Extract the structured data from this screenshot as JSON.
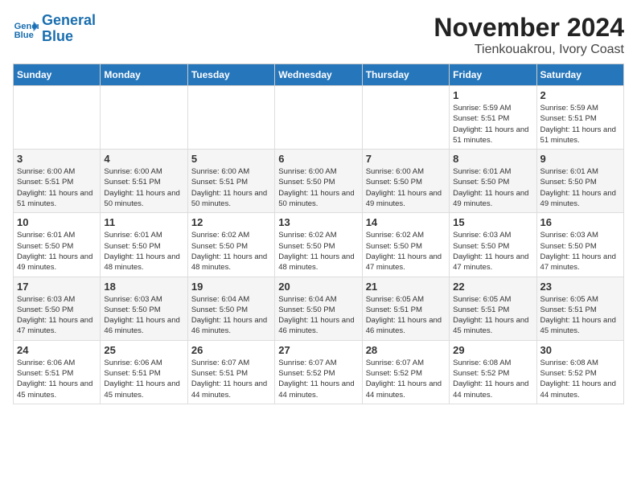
{
  "logo": {
    "line1": "General",
    "line2": "Blue"
  },
  "title": "November 2024",
  "subtitle": "Tienkouakrou, Ivory Coast",
  "days_of_week": [
    "Sunday",
    "Monday",
    "Tuesday",
    "Wednesday",
    "Thursday",
    "Friday",
    "Saturday"
  ],
  "weeks": [
    [
      {
        "day": "",
        "info": ""
      },
      {
        "day": "",
        "info": ""
      },
      {
        "day": "",
        "info": ""
      },
      {
        "day": "",
        "info": ""
      },
      {
        "day": "",
        "info": ""
      },
      {
        "day": "1",
        "info": "Sunrise: 5:59 AM\nSunset: 5:51 PM\nDaylight: 11 hours and 51 minutes."
      },
      {
        "day": "2",
        "info": "Sunrise: 5:59 AM\nSunset: 5:51 PM\nDaylight: 11 hours and 51 minutes."
      }
    ],
    [
      {
        "day": "3",
        "info": "Sunrise: 6:00 AM\nSunset: 5:51 PM\nDaylight: 11 hours and 51 minutes."
      },
      {
        "day": "4",
        "info": "Sunrise: 6:00 AM\nSunset: 5:51 PM\nDaylight: 11 hours and 50 minutes."
      },
      {
        "day": "5",
        "info": "Sunrise: 6:00 AM\nSunset: 5:51 PM\nDaylight: 11 hours and 50 minutes."
      },
      {
        "day": "6",
        "info": "Sunrise: 6:00 AM\nSunset: 5:50 PM\nDaylight: 11 hours and 50 minutes."
      },
      {
        "day": "7",
        "info": "Sunrise: 6:00 AM\nSunset: 5:50 PM\nDaylight: 11 hours and 49 minutes."
      },
      {
        "day": "8",
        "info": "Sunrise: 6:01 AM\nSunset: 5:50 PM\nDaylight: 11 hours and 49 minutes."
      },
      {
        "day": "9",
        "info": "Sunrise: 6:01 AM\nSunset: 5:50 PM\nDaylight: 11 hours and 49 minutes."
      }
    ],
    [
      {
        "day": "10",
        "info": "Sunrise: 6:01 AM\nSunset: 5:50 PM\nDaylight: 11 hours and 49 minutes."
      },
      {
        "day": "11",
        "info": "Sunrise: 6:01 AM\nSunset: 5:50 PM\nDaylight: 11 hours and 48 minutes."
      },
      {
        "day": "12",
        "info": "Sunrise: 6:02 AM\nSunset: 5:50 PM\nDaylight: 11 hours and 48 minutes."
      },
      {
        "day": "13",
        "info": "Sunrise: 6:02 AM\nSunset: 5:50 PM\nDaylight: 11 hours and 48 minutes."
      },
      {
        "day": "14",
        "info": "Sunrise: 6:02 AM\nSunset: 5:50 PM\nDaylight: 11 hours and 47 minutes."
      },
      {
        "day": "15",
        "info": "Sunrise: 6:03 AM\nSunset: 5:50 PM\nDaylight: 11 hours and 47 minutes."
      },
      {
        "day": "16",
        "info": "Sunrise: 6:03 AM\nSunset: 5:50 PM\nDaylight: 11 hours and 47 minutes."
      }
    ],
    [
      {
        "day": "17",
        "info": "Sunrise: 6:03 AM\nSunset: 5:50 PM\nDaylight: 11 hours and 47 minutes."
      },
      {
        "day": "18",
        "info": "Sunrise: 6:03 AM\nSunset: 5:50 PM\nDaylight: 11 hours and 46 minutes."
      },
      {
        "day": "19",
        "info": "Sunrise: 6:04 AM\nSunset: 5:50 PM\nDaylight: 11 hours and 46 minutes."
      },
      {
        "day": "20",
        "info": "Sunrise: 6:04 AM\nSunset: 5:50 PM\nDaylight: 11 hours and 46 minutes."
      },
      {
        "day": "21",
        "info": "Sunrise: 6:05 AM\nSunset: 5:51 PM\nDaylight: 11 hours and 46 minutes."
      },
      {
        "day": "22",
        "info": "Sunrise: 6:05 AM\nSunset: 5:51 PM\nDaylight: 11 hours and 45 minutes."
      },
      {
        "day": "23",
        "info": "Sunrise: 6:05 AM\nSunset: 5:51 PM\nDaylight: 11 hours and 45 minutes."
      }
    ],
    [
      {
        "day": "24",
        "info": "Sunrise: 6:06 AM\nSunset: 5:51 PM\nDaylight: 11 hours and 45 minutes."
      },
      {
        "day": "25",
        "info": "Sunrise: 6:06 AM\nSunset: 5:51 PM\nDaylight: 11 hours and 45 minutes."
      },
      {
        "day": "26",
        "info": "Sunrise: 6:07 AM\nSunset: 5:51 PM\nDaylight: 11 hours and 44 minutes."
      },
      {
        "day": "27",
        "info": "Sunrise: 6:07 AM\nSunset: 5:52 PM\nDaylight: 11 hours and 44 minutes."
      },
      {
        "day": "28",
        "info": "Sunrise: 6:07 AM\nSunset: 5:52 PM\nDaylight: 11 hours and 44 minutes."
      },
      {
        "day": "29",
        "info": "Sunrise: 6:08 AM\nSunset: 5:52 PM\nDaylight: 11 hours and 44 minutes."
      },
      {
        "day": "30",
        "info": "Sunrise: 6:08 AM\nSunset: 5:52 PM\nDaylight: 11 hours and 44 minutes."
      }
    ]
  ]
}
